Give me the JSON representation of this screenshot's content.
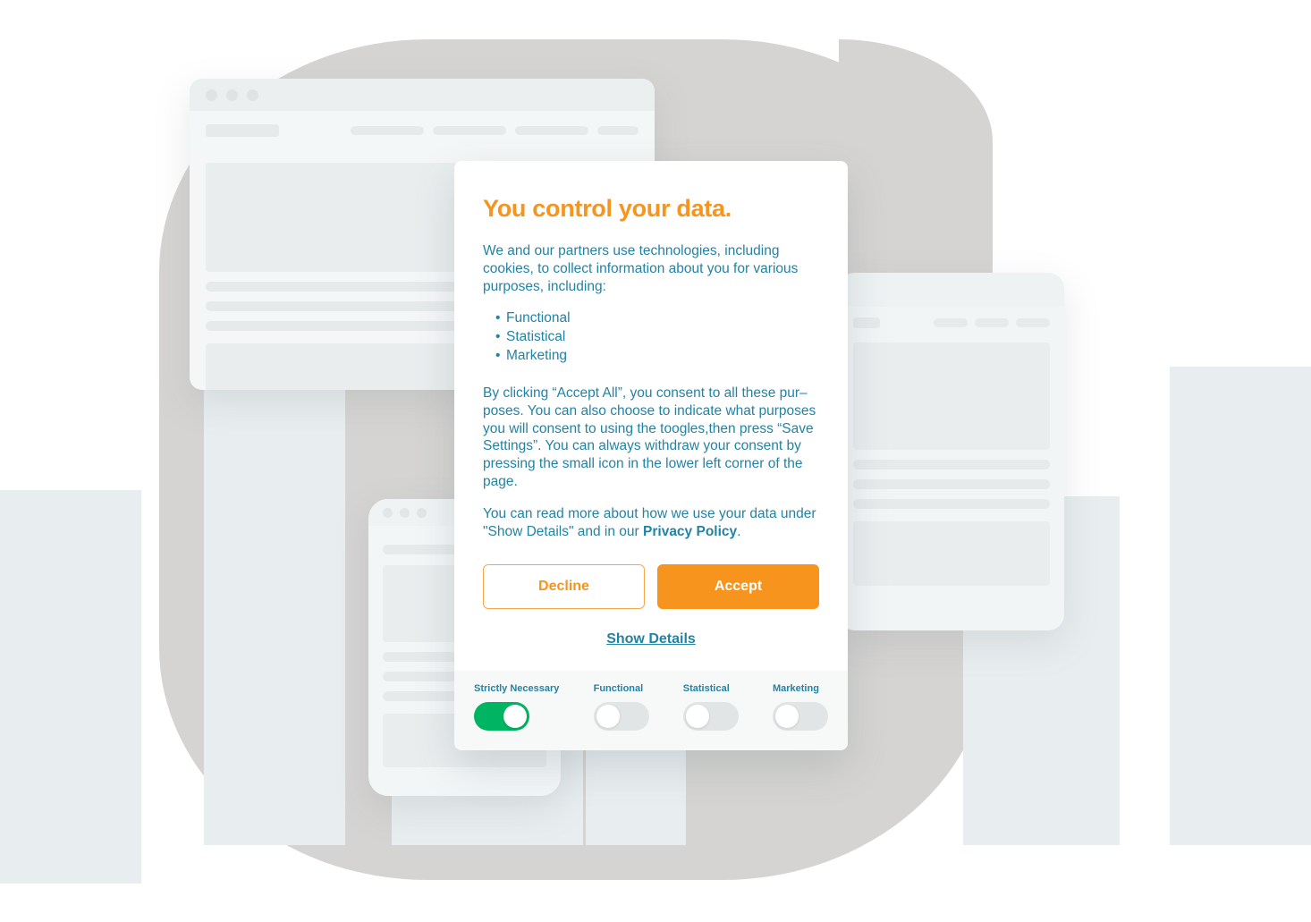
{
  "card": {
    "title": "You control your data.",
    "intro": "We and our partners use technologies, including cookies, to collect information about you for various purposes, including:",
    "purposes": [
      "Functional",
      "Statistical",
      "Marketing"
    ],
    "consent_paragraph": "By clicking “Accept All”, you consent to all these pur–poses. You can also choose to indicate what purposes you will consent to using the toogles,then press “Save Settings”. You can always withdraw your consent by pressing the small icon in the lower left corner of the page.",
    "details_paragraph_prefix": "You can read more about how we use your data under \"Show Details\" and in our ",
    "privacy_policy_label": "Privacy Policy",
    "details_paragraph_suffix": ".",
    "decline_label": "Decline",
    "accept_label": "Accept",
    "show_details_label": "Show Details"
  },
  "toggles": [
    {
      "label": "Strictly Necessary",
      "state": "on"
    },
    {
      "label": "Functional",
      "state": "off"
    },
    {
      "label": "Statistical",
      "state": "off"
    },
    {
      "label": "Marketing",
      "state": "off"
    }
  ],
  "colors": {
    "accent_orange": "#F7941E",
    "teal_text": "#2383A4",
    "toggle_on_green": "#00B562",
    "toggle_off_gray": "#E2E5E6",
    "pale_rect": "#E8EEF0",
    "blob_gray": "#D5D4D2",
    "card_background": "#FFFFFF",
    "toggle_strip_background": "#F7F8F8"
  }
}
